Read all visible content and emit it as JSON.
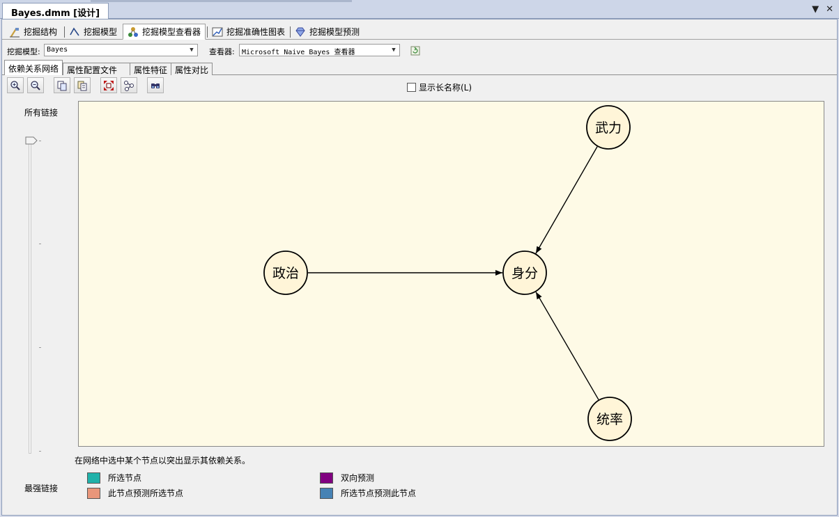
{
  "document": {
    "tab_title": "Bayes.dmm [设计]"
  },
  "window_buttons": {
    "dropdown": "▼",
    "close": "✕"
  },
  "main_tabs": [
    {
      "label": "挖掘结构",
      "icon": "mining-structure-icon"
    },
    {
      "label": "挖掘模型",
      "icon": "mining-model-icon"
    },
    {
      "label": "挖掘模型查看器",
      "icon": "model-viewer-icon",
      "active": true
    },
    {
      "label": "挖掘准确性图表",
      "icon": "accuracy-chart-icon"
    },
    {
      "label": "挖掘模型预测",
      "icon": "prediction-icon"
    }
  ],
  "model_selector": {
    "label": "挖掘模型:",
    "value": "Bayes"
  },
  "viewer_selector": {
    "label": "查看器:",
    "value": "Microsoft Naive Bayes 查看器"
  },
  "sub_tabs": [
    {
      "label": "依赖关系网络",
      "active": true
    },
    {
      "label": "属性配置文件"
    },
    {
      "label": "属性特征"
    },
    {
      "label": "属性对比"
    }
  ],
  "toolbar": {
    "buttons": [
      "zoom-in-icon",
      "zoom-out-icon",
      "copy-icon",
      "copy-graph-icon",
      "fit-to-window-icon",
      "layout-icon",
      "find-node-icon"
    ]
  },
  "show_long_names": {
    "label": "显示长名称(L)",
    "checked": false
  },
  "slider": {
    "top_label": "所有链接",
    "bottom_label": "最强链接",
    "position": 0
  },
  "network": {
    "nodes": [
      {
        "id": "wuli",
        "label": "武力"
      },
      {
        "id": "zhengzhi",
        "label": "政治"
      },
      {
        "id": "shenfen",
        "label": "身分"
      },
      {
        "id": "tongshuai",
        "label": "统率"
      }
    ],
    "edges": [
      {
        "from": "wuli",
        "to": "shenfen"
      },
      {
        "from": "zhengzhi",
        "to": "shenfen"
      },
      {
        "from": "tongshuai",
        "to": "shenfen"
      }
    ],
    "background_color": "#fefae6"
  },
  "hint": "在网络中选中某个节点以突出显示其依赖关系。",
  "legend": [
    {
      "label": "所选节点",
      "color": "#20b2aa"
    },
    {
      "label": "双向预测",
      "color": "#800080"
    },
    {
      "label": "此节点预测所选节点",
      "color": "#e9967a"
    },
    {
      "label": "所选节点预测此节点",
      "color": "#4682b4"
    }
  ]
}
